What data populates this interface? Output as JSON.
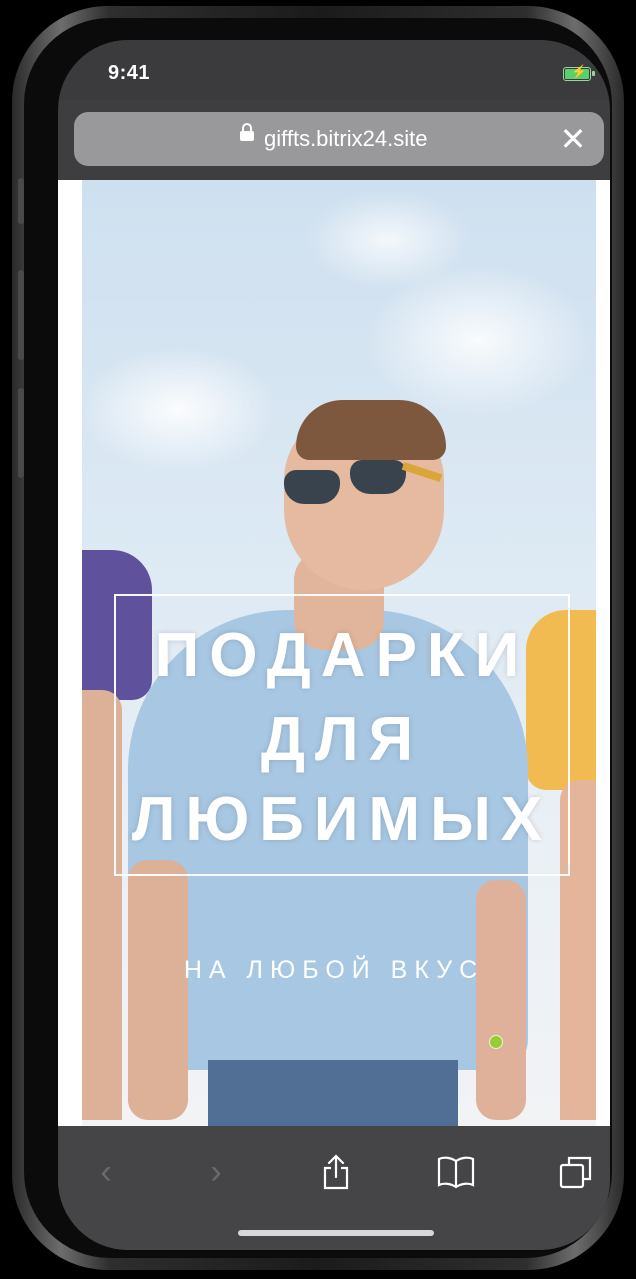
{
  "status_bar": {
    "time": "9:41",
    "battery_level": 1.0,
    "battery_color": "#55d36a"
  },
  "browser": {
    "url": "giffts.bitrix24.site",
    "close_icon": "close-icon",
    "load_progress": 0.1
  },
  "hero": {
    "title_lines": [
      "ПОДАРКИ",
      "ДЛЯ",
      "ЛЮБИМЫХ"
    ],
    "subtitle": "НА ЛЮБОЙ ВКУС"
  },
  "toolbar": {
    "buttons": [
      "back-icon",
      "forward-icon",
      "share-icon",
      "bookmarks-icon",
      "tabs-icon"
    ]
  },
  "colors": {
    "bar_bg": "#3b3b3d",
    "toolbar_bg": "#454548",
    "accent_green": "#9ac93a"
  }
}
